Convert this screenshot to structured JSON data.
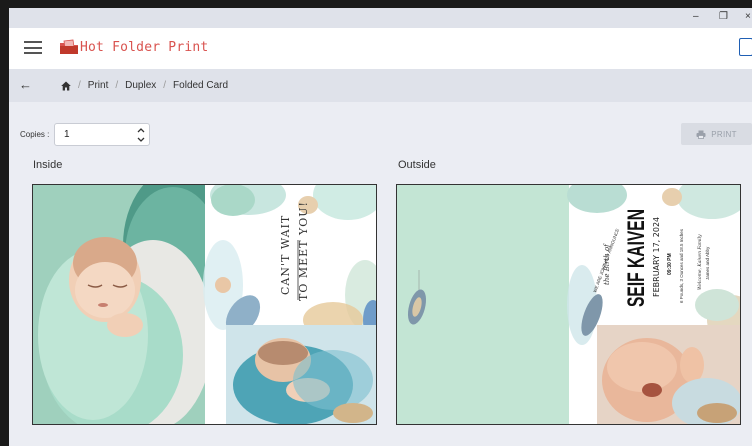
{
  "window": {
    "minimize": "–",
    "restore": "❐",
    "close": "×"
  },
  "app": {
    "title": "Hot Folder Print",
    "colors": {
      "brand": "#d9534f",
      "accent": "#1f5fb4"
    }
  },
  "breadcrumb": {
    "items": [
      "Print",
      "Duplex",
      "Folded Card"
    ]
  },
  "copies": {
    "label": "Copies :",
    "value": "1"
  },
  "print_button": {
    "label": "PRINT"
  },
  "panels": {
    "inside": {
      "label": "Inside",
      "card_text": [
        "CAN'T WAIT",
        "TO MEET YOU!"
      ]
    },
    "outside": {
      "label": "Outside",
      "announcement": {
        "intro": "WE ARE JOYFULLY ANNOUNCE",
        "subtitle": "the Birth of",
        "name": "SEIF KAIVEN",
        "date": "FEBRUARY 17, 2024",
        "time": "09:30 PM",
        "stats": "6 Pounds, 3 Ounces and 18.5 Inches",
        "welcome": "Welcome, Kaiven Family",
        "parents": "James and Abby"
      }
    }
  }
}
